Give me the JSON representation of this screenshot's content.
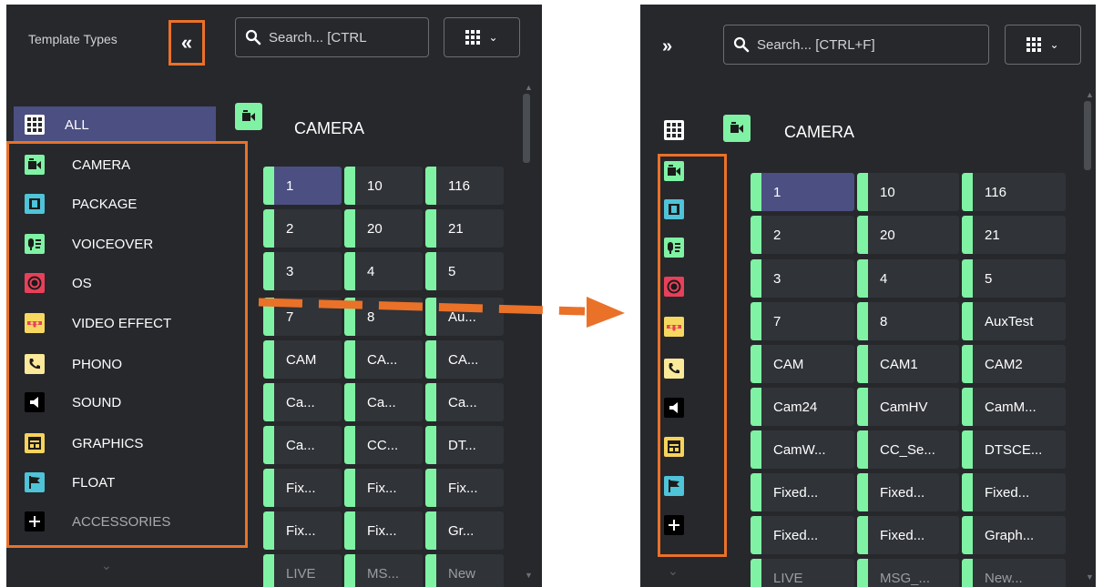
{
  "left": {
    "header_title": "Template Types",
    "collapse_glyph": "«",
    "search_placeholder": "Search... [CTRL",
    "nav_all_label": "ALL",
    "nav_items": [
      {
        "label": "CAMERA",
        "icon": "camera-icon",
        "color": "#7ff2a4"
      },
      {
        "label": "PACKAGE",
        "icon": "film-icon",
        "color": "#4fc3d8"
      },
      {
        "label": "VOICEOVER",
        "icon": "voiceover-icon",
        "color": "#7ff2a4"
      },
      {
        "label": "OS",
        "icon": "record-icon",
        "color": "#e8405a"
      },
      {
        "label": "VIDEO EFFECT",
        "icon": "video-effect-icon",
        "color": "#f6d860"
      },
      {
        "label": "PHONO",
        "icon": "phone-icon",
        "color": "#fbe99a"
      },
      {
        "label": "SOUND",
        "icon": "speaker-icon",
        "color": "#000000"
      },
      {
        "label": "GRAPHICS",
        "icon": "graphics-icon",
        "color": "#f7d35c"
      },
      {
        "label": "FLOAT",
        "icon": "flag-icon",
        "color": "#4fc3d8"
      },
      {
        "label": "ACCESSORIES",
        "icon": "plus-icon",
        "color": "#000000"
      }
    ],
    "category_title": "CAMERA",
    "tiles": [
      [
        "1",
        "10",
        "116"
      ],
      [
        "2",
        "20",
        "21"
      ],
      [
        "3",
        "4",
        "5"
      ],
      [
        "7",
        "8",
        "Au..."
      ],
      [
        "CAM",
        "CA...",
        "CA..."
      ],
      [
        "Ca...",
        "Ca...",
        "Ca..."
      ],
      [
        "Ca...",
        "CC...",
        "DT..."
      ],
      [
        "Fix...",
        "Fix...",
        "Fix..."
      ],
      [
        "Fix...",
        "Fix...",
        "Gr..."
      ],
      [
        "LIVE",
        "MS...",
        "New"
      ]
    ]
  },
  "right": {
    "expand_glyph": "»",
    "search_placeholder": "Search... [CTRL+F]",
    "category_title": "CAMERA",
    "tiles": [
      [
        "1",
        "10",
        "116"
      ],
      [
        "2",
        "20",
        "21"
      ],
      [
        "3",
        "4",
        "5"
      ],
      [
        "7",
        "8",
        "AuxTest"
      ],
      [
        "CAM",
        "CAM1",
        "CAM2"
      ],
      [
        "Cam24",
        "CamHV",
        "CamM..."
      ],
      [
        "CamW...",
        "CC_Se...",
        "DTSCE..."
      ],
      [
        "Fixed...",
        "Fixed...",
        "Fixed..."
      ],
      [
        "Fixed...",
        "Fixed...",
        "Graph..."
      ],
      [
        "LIVE",
        "MSG_...",
        "New..."
      ]
    ]
  },
  "colors": {
    "panel_bg": "#26282c",
    "highlight_orange": "#ea7128",
    "selected_bg": "#4c4f82",
    "camera_accent": "#7ff2a4"
  }
}
